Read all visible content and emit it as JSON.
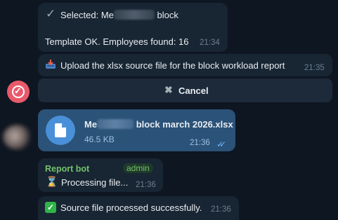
{
  "messages": {
    "selected": {
      "icon": "checkmark-icon",
      "text_prefix": "Selected: Me",
      "text_suffix": "block",
      "template_text": "Template OK. Employees found: 16",
      "time": "21:34"
    },
    "upload_prompt": {
      "icon": "inbox-tray-icon",
      "text": "Upload the xlsx source file for the block workload report",
      "time": "21:35"
    },
    "cancel_button": {
      "icon": "x-mark-icon",
      "label": "Cancel"
    },
    "file": {
      "icon": "document-icon",
      "name_prefix": "Me",
      "name_suffix": "block march 2026.xlsx",
      "size": "46.5 KB",
      "time": "21:36",
      "status": "read-double-check"
    },
    "processing": {
      "sender": "Report bot",
      "badge": "admin",
      "icon": "hourglass-icon",
      "text": "Processing file...",
      "time": "21:36"
    },
    "success": {
      "icon": "green-check-icon",
      "text": "Source file processed successfully.",
      "time": "21:36"
    }
  },
  "colors": {
    "background": "#0e1621",
    "incoming_bubble": "#182533",
    "outgoing_bubble": "#2b5278",
    "file_icon_circle": "#4a90d9",
    "sender_name": "#73c36b",
    "check_blue": "#6cb6ff",
    "bot_avatar": "#e85a6b"
  }
}
